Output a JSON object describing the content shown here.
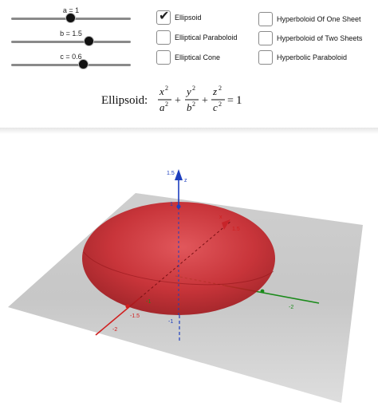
{
  "sliders": [
    {
      "label": "a = 1",
      "value": 1,
      "min": 0,
      "max": 2
    },
    {
      "label": "b = 1.5",
      "value": 1.5,
      "min": 0,
      "max": 3
    },
    {
      "label": "c = 0.6",
      "value": 0.6,
      "min": 0,
      "max": 1
    }
  ],
  "checkboxes": [
    {
      "label": "Ellipsoid",
      "checked": true
    },
    {
      "label": "Elliptical Paraboloid",
      "checked": false
    },
    {
      "label": "Elliptical Cone",
      "checked": false
    },
    {
      "label": "Hyperboloid Of One Sheet",
      "checked": false
    },
    {
      "label": "Hyperboloid of Two Sheets",
      "checked": false
    },
    {
      "label": "Hyperbolic Paraboloid",
      "checked": false
    }
  ],
  "formula": {
    "name": "Ellipsoid",
    "colon": ":",
    "x": "x",
    "y": "y",
    "z": "z",
    "a": "a",
    "b": "b",
    "c": "c",
    "exp": "2",
    "plus": "+",
    "equals": "=",
    "rhs": "1"
  },
  "scene": {
    "axis_z_label": "z",
    "axis_x_label": "x",
    "ticks": {
      "z_top": "1.5",
      "z_one": "1",
      "z_neg_one": "-1",
      "x_one_five": "1.5",
      "x_neg_one": "-1",
      "x_neg_one_five": "-1.5",
      "x_neg_two": "-2",
      "y_neg_two": "-2",
      "y_neg_one": "-1"
    },
    "colors": {
      "surface": "#c8242a",
      "plane": "#b9b9b9",
      "x_axis": "#d01f1f",
      "y_axis": "#1a8a1a",
      "z_axis": "#1e3fbf"
    }
  }
}
